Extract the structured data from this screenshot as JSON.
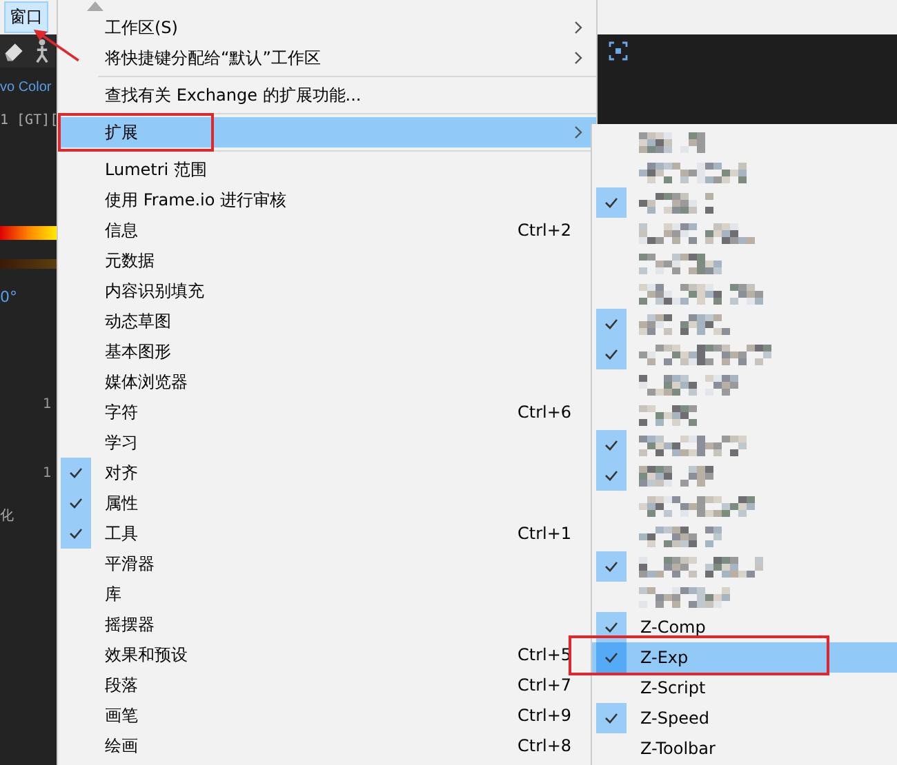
{
  "menu_bar": {
    "items": [
      {
        "label": "窗口",
        "selected": true
      }
    ]
  },
  "left_panel": {
    "texts": [
      {
        "kind": "label",
        "text": "vo Color"
      },
      {
        "kind": "code",
        "text": "1 [GT]["
      },
      {
        "kind": "value",
        "text": "0°"
      },
      {
        "kind": "tick",
        "text": "1"
      },
      {
        "kind": "tick",
        "text": "1"
      },
      {
        "kind": "label",
        "text": "化"
      }
    ]
  },
  "window_menu": {
    "items": [
      {
        "kind": "submenu",
        "label": "工作区(S)",
        "checked": false,
        "selected": false
      },
      {
        "kind": "submenu",
        "label": "将快捷键分配给“默认”工作区",
        "checked": false,
        "selected": false
      },
      {
        "kind": "separator"
      },
      {
        "kind": "item",
        "label": "查找有关 Exchange 的扩展功能...",
        "checked": false,
        "selected": false
      },
      {
        "kind": "separator"
      },
      {
        "kind": "submenu",
        "label": "扩展",
        "checked": false,
        "selected": true
      },
      {
        "kind": "separator"
      },
      {
        "kind": "item",
        "label": "Lumetri 范围",
        "checked": false,
        "selected": false
      },
      {
        "kind": "item",
        "label": "使用 Frame.io 进行审核",
        "checked": false,
        "selected": false
      },
      {
        "kind": "item",
        "label": "信息",
        "shortcut": "Ctrl+2",
        "checked": false,
        "selected": false
      },
      {
        "kind": "item",
        "label": "元数据",
        "checked": false,
        "selected": false
      },
      {
        "kind": "item",
        "label": "内容识别填充",
        "checked": false,
        "selected": false
      },
      {
        "kind": "item",
        "label": "动态草图",
        "checked": false,
        "selected": false
      },
      {
        "kind": "item",
        "label": "基本图形",
        "checked": false,
        "selected": false
      },
      {
        "kind": "item",
        "label": "媒体浏览器",
        "checked": false,
        "selected": false
      },
      {
        "kind": "item",
        "label": "字符",
        "shortcut": "Ctrl+6",
        "checked": false,
        "selected": false
      },
      {
        "kind": "item",
        "label": "学习",
        "checked": false,
        "selected": false
      },
      {
        "kind": "item",
        "label": "对齐",
        "checked": true,
        "selected": false
      },
      {
        "kind": "item",
        "label": "属性",
        "checked": true,
        "selected": false
      },
      {
        "kind": "item",
        "label": "工具",
        "shortcut": "Ctrl+1",
        "checked": true,
        "selected": false
      },
      {
        "kind": "item",
        "label": "平滑器",
        "checked": false,
        "selected": false
      },
      {
        "kind": "item",
        "label": "库",
        "checked": false,
        "selected": false
      },
      {
        "kind": "item",
        "label": "摇摆器",
        "checked": false,
        "selected": false
      },
      {
        "kind": "item",
        "label": "效果和预设",
        "shortcut": "Ctrl+5",
        "checked": false,
        "selected": false
      },
      {
        "kind": "item",
        "label": "段落",
        "shortcut": "Ctrl+7",
        "checked": false,
        "selected": false
      },
      {
        "kind": "item",
        "label": "画笔",
        "shortcut": "Ctrl+9",
        "checked": false,
        "selected": false
      },
      {
        "kind": "item",
        "label": "绘画",
        "shortcut": "Ctrl+8",
        "checked": false,
        "selected": false
      }
    ]
  },
  "extensions_submenu": {
    "items": [
      {
        "kind": "redacted",
        "checked": false,
        "selected": false
      },
      {
        "kind": "redacted",
        "checked": false,
        "selected": false
      },
      {
        "kind": "redacted",
        "checked": true,
        "selected": false
      },
      {
        "kind": "redacted",
        "checked": false,
        "selected": false
      },
      {
        "kind": "redacted",
        "checked": false,
        "selected": false
      },
      {
        "kind": "redacted",
        "checked": false,
        "selected": false
      },
      {
        "kind": "redacted",
        "checked": true,
        "selected": false
      },
      {
        "kind": "redacted",
        "checked": true,
        "selected": false
      },
      {
        "kind": "redacted",
        "checked": false,
        "selected": false
      },
      {
        "kind": "redacted",
        "checked": false,
        "selected": false
      },
      {
        "kind": "redacted",
        "checked": true,
        "selected": false
      },
      {
        "kind": "redacted",
        "checked": true,
        "selected": false
      },
      {
        "kind": "redacted",
        "checked": false,
        "selected": false
      },
      {
        "kind": "redacted",
        "checked": false,
        "selected": false
      },
      {
        "kind": "redacted",
        "checked": true,
        "selected": false
      },
      {
        "kind": "redacted",
        "checked": false,
        "selected": false
      },
      {
        "kind": "item",
        "label": "Z-Comp",
        "checked": true,
        "selected": false
      },
      {
        "kind": "item",
        "label": "Z-Exp",
        "checked": true,
        "selected": true
      },
      {
        "kind": "item",
        "label": "Z-Script",
        "checked": false,
        "selected": false
      },
      {
        "kind": "item",
        "label": "Z-Speed",
        "checked": true,
        "selected": false
      },
      {
        "kind": "item",
        "label": "Z-Toolbar",
        "checked": false,
        "selected": false
      }
    ]
  }
}
